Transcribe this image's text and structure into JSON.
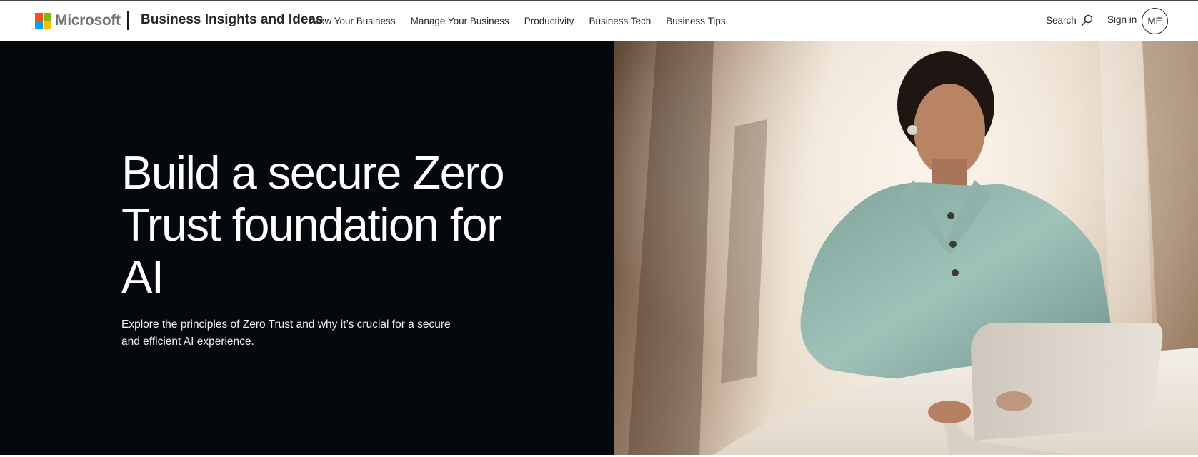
{
  "header": {
    "brand": "Microsoft",
    "logo_colors": [
      "#f25022",
      "#7fba00",
      "#00a4ef",
      "#ffb900"
    ],
    "site_title": "Business Insights and Ideas",
    "nav": [
      {
        "label": "Grow Your Business"
      },
      {
        "label": "Manage Your Business"
      },
      {
        "label": "Productivity"
      },
      {
        "label": "Business Tech"
      },
      {
        "label": "Business Tips"
      }
    ],
    "search_label": "Search",
    "signin_label": "Sign in",
    "avatar_initials": "ME"
  },
  "hero": {
    "title": "Build a secure Zero Trust foundation for AI",
    "subtitle": "Explore the principles of Zero Trust and why it’s crucial for a secure and efficient AI experience.",
    "background_color": "#05080d"
  }
}
